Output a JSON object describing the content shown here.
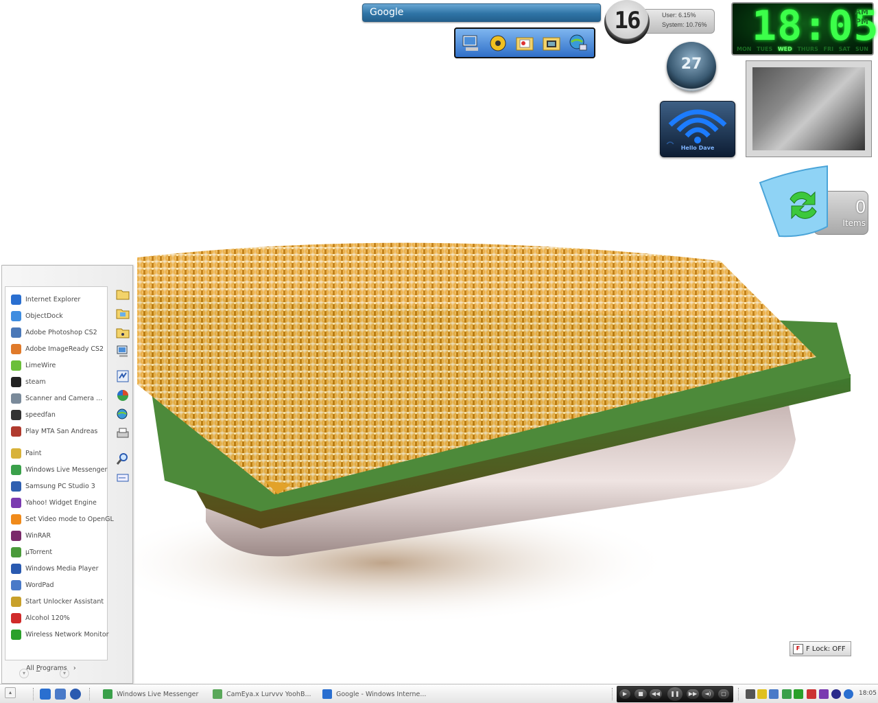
{
  "google": {
    "label": "Google"
  },
  "cpu": {
    "value": "16",
    "user": "User: 6.15%",
    "system": "System: 10.76%"
  },
  "clock": {
    "time": "18:05",
    "am": "AM",
    "pm": "PM",
    "days": [
      "MON",
      "TUES",
      "WED",
      "THURS",
      "FRI",
      "SAT",
      "SUN"
    ],
    "active_day": "WED"
  },
  "calendar": {
    "day": "27"
  },
  "wifi": {
    "label": "Hello Dave"
  },
  "recycle_bin": {
    "count": "0",
    "label": "Items"
  },
  "start_menu": {
    "programs": [
      {
        "label": "Internet Explorer",
        "icon": "ie-icon",
        "color": "#2a6fd0"
      },
      {
        "label": "ObjectDock",
        "icon": "objectdock-icon",
        "color": "#3f8de0"
      },
      {
        "label": "Adobe Photoshop CS2",
        "icon": "photoshop-icon",
        "color": "#4a78b8"
      },
      {
        "label": "Adobe ImageReady CS2",
        "icon": "imageready-icon",
        "color": "#e07a2a"
      },
      {
        "label": "LimeWire",
        "icon": "limewire-icon",
        "color": "#6bbf3a"
      },
      {
        "label": "steam",
        "icon": "steam-icon",
        "color": "#222222"
      },
      {
        "label": "Scanner and Camera ...",
        "icon": "scanner-icon",
        "color": "#7a8a9a"
      },
      {
        "label": "speedfan",
        "icon": "speedfan-icon",
        "color": "#333333"
      },
      {
        "label": "Play MTA San Andreas",
        "icon": "mta-icon",
        "color": "#b03a2e"
      },
      {
        "label": "Paint",
        "icon": "paint-icon",
        "color": "#d8b23a"
      },
      {
        "label": "Windows Live Messenger",
        "icon": "messenger-icon",
        "color": "#3aa04a"
      },
      {
        "label": "Samsung PC Studio 3",
        "icon": "samsung-icon",
        "color": "#2f5fb0"
      },
      {
        "label": "Yahoo! Widget Engine",
        "icon": "yahoo-widget-icon",
        "color": "#7a3ab0"
      },
      {
        "label": "Set Video mode to OpenGL",
        "icon": "vlc-cone-icon",
        "color": "#f08a1a"
      },
      {
        "label": "WinRAR",
        "icon": "winrar-icon",
        "color": "#7a2a6a"
      },
      {
        "label": "µTorrent",
        "icon": "utorrent-icon",
        "color": "#4a9a3a"
      },
      {
        "label": "Windows Media Player",
        "icon": "wmp-icon",
        "color": "#2a5ab0"
      },
      {
        "label": "WordPad",
        "icon": "wordpad-icon",
        "color": "#4a7ac8"
      },
      {
        "label": "Start Unlocker Assistant",
        "icon": "unlocker-icon",
        "color": "#c8a02a"
      },
      {
        "label": "Alcohol 120%",
        "icon": "alcohol-icon",
        "color": "#d02a2a"
      },
      {
        "label": "Wireless Network Monitor",
        "icon": "network-monitor-icon",
        "color": "#2aa02a"
      }
    ],
    "all_programs_prefix": "All ",
    "all_programs_underlined": "P",
    "all_programs_suffix": "rograms",
    "all_programs_arrow": "›"
  },
  "flock": {
    "label": "F Lock: OFF"
  },
  "taskbar": {
    "windows": [
      {
        "label": "Windows Live Messenger",
        "icon": "messenger-icon",
        "color": "#3aa04a"
      },
      {
        "label": "CamEya.x Lurvvv YoohB...",
        "icon": "messenger-chat-icon",
        "color": "#5aa85a"
      },
      {
        "label": "Google - Windows Interne...",
        "icon": "ie-icon",
        "color": "#2a6fd0"
      }
    ],
    "time": "18:05"
  }
}
